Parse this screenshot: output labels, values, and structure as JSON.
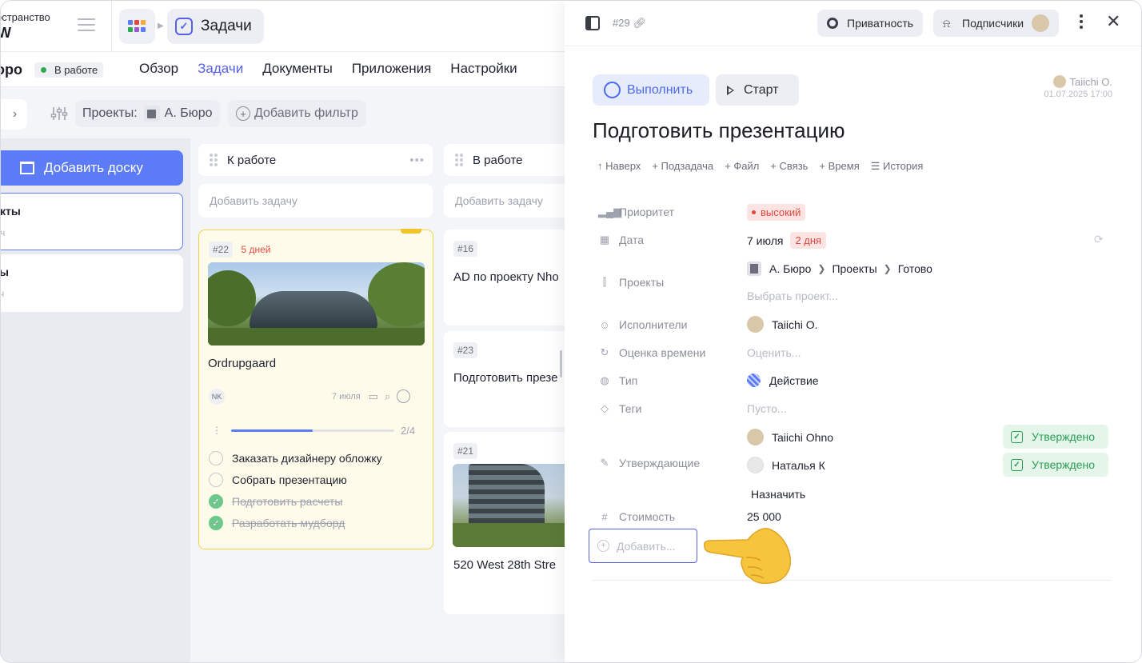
{
  "workspace": {
    "label_line1": "остранство",
    "label_line2": "W"
  },
  "header": {
    "current_section": "Задачи"
  },
  "project": {
    "name": "оро",
    "status": "В работе",
    "tabs": [
      "Обзор",
      "Задачи",
      "Документы",
      "Приложения",
      "Настройки"
    ],
    "active_tab": "Задачи"
  },
  "filters": {
    "projects_label": "Проекты:",
    "project_value": "А. Бюро",
    "add_filter": "Добавить фильтр"
  },
  "sidebar": {
    "add_board": "Добавить доску",
    "boards": [
      {
        "title": "кты",
        "subtitle": "ч"
      },
      {
        "title": "ы",
        "subtitle": "ч"
      }
    ]
  },
  "columns": [
    {
      "title": "К работе",
      "add_task": "Добавить задачу"
    },
    {
      "title": "В работе",
      "add_task": "Добавить задачу"
    }
  ],
  "cards": {
    "c22": {
      "number": "#22",
      "days": "5 дней",
      "title": "Ordrupgaard",
      "assignee": "NK",
      "date": "7 июля",
      "progress_text": "2/4",
      "progress": 0.5,
      "subtasks": [
        {
          "text": "Заказать дизайнеру обложку",
          "done": false
        },
        {
          "text": "Собрать презентацию",
          "done": false
        },
        {
          "text": "Подготовить расчеты",
          "done": true
        },
        {
          "text": "Разработать мудборд",
          "done": true
        }
      ]
    },
    "c16": {
      "number": "#16",
      "title": "AD по проекту Nho"
    },
    "c23": {
      "number": "#23",
      "title": "Подготовить презе"
    },
    "c21": {
      "number": "#21",
      "title": "520 West 28th Stre"
    }
  },
  "panel": {
    "task_number": "#29",
    "privacy": "Приватность",
    "subscribers": "Подписчики",
    "complete": "Выполнить",
    "start": "Старт",
    "author_name": "Taiichi O.",
    "author_date": "01.07.2025 17:00",
    "title": "Подготовить презентацию",
    "quick_actions": [
      "↑ Наверх",
      "+ Подзадача",
      "+ Файл",
      "+ Связь",
      "+ Время",
      "☰ История"
    ],
    "props": {
      "priority_label": "Приоритет",
      "priority_value": "высокий",
      "date_label": "Дата",
      "date_value": "7 июля",
      "date_days": "2 дня",
      "projects_label": "Проекты",
      "project_path": [
        "А. Бюро",
        "Проекты",
        "Готово"
      ],
      "choose_project": "Выбрать проект...",
      "assignees_label": "Исполнители",
      "assignee": "Taiichi O.",
      "estimate_label": "Оценка времени",
      "estimate_placeholder": "Оценить...",
      "type_label": "Тип",
      "type_value": "Действие",
      "tags_label": "Теги",
      "tags_placeholder": "Пусто...",
      "approvers_label": "Утверждающие",
      "approvers": [
        {
          "name": "Taiichi Ohno",
          "status": "Утверждено"
        },
        {
          "name": "Наталья К",
          "status": "Утверждено"
        }
      ],
      "assign": "Назначить",
      "cost_label": "Стоимость",
      "cost_value": "25 000",
      "add_field": "Добавить..."
    }
  },
  "colors": {
    "accent": "#5561e8",
    "primary_button": "#5b7cf6",
    "danger": "#e0493f",
    "success": "#2c9c54",
    "highlight_card": "#fffbea"
  }
}
